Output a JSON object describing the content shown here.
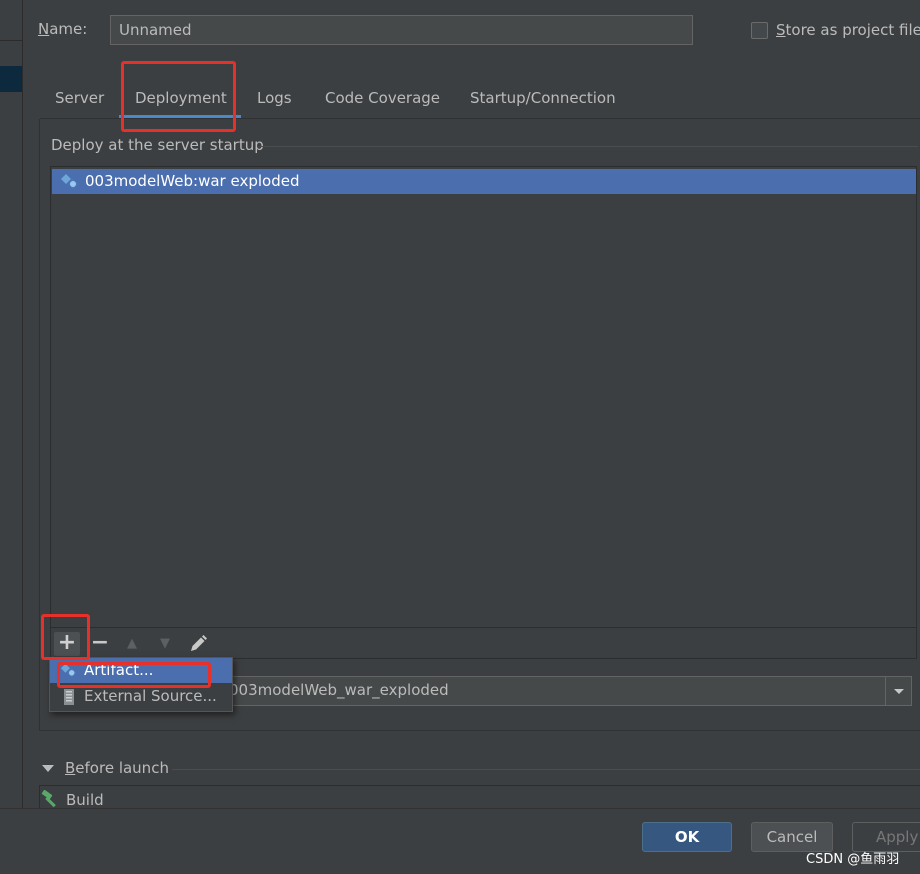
{
  "dialog": {
    "name_label_mnemonic": "N",
    "name_label_rest": "ame:",
    "name_value": "Unnamed",
    "store_label_mnemonic": "S",
    "store_label_rest": "tore as project file",
    "store_checked": false
  },
  "tabs": [
    {
      "label": "Server",
      "selected": false
    },
    {
      "label": "Deployment",
      "selected": true
    },
    {
      "label": "Logs",
      "selected": false
    },
    {
      "label": "Code Coverage",
      "selected": false
    },
    {
      "label": "Startup/Connection",
      "selected": false
    }
  ],
  "deployment": {
    "section_title": "Deploy at the server startup",
    "artifacts": [
      {
        "label": "003modelWeb:war exploded",
        "icon": "artifact-icon",
        "selected": true
      }
    ],
    "toolbar": {
      "add": "+",
      "remove": "−",
      "up": "▲",
      "down": "▼",
      "edit_icon": "pencil-icon"
    },
    "context_value": "003modelWeb_war_exploded"
  },
  "popup_menu": [
    {
      "label": "Artifact...",
      "icon": "artifact-icon",
      "highlighted": true
    },
    {
      "label": "External Source...",
      "icon": "jar-icon",
      "highlighted": false
    }
  ],
  "before_launch": {
    "label_mnemonic": "B",
    "label_rest": "efore launch",
    "items": [
      {
        "label": "Build",
        "icon": "hammer-icon"
      }
    ]
  },
  "buttons": {
    "ok": "OK",
    "cancel": "Cancel",
    "apply": "Apply"
  },
  "watermark": "CSDN @鱼雨羽",
  "colors": {
    "background": "#3c3f41",
    "selection": "#4b6eaf",
    "accent_underline": "#4a88c7",
    "ok_button": "#365880",
    "annotation_red": "#e8302a"
  }
}
